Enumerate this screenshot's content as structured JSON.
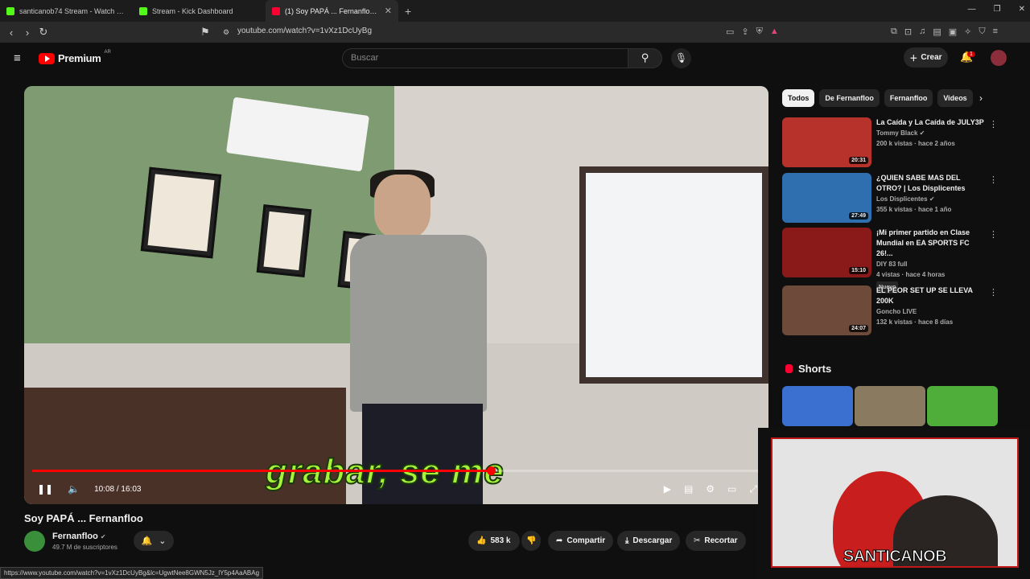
{
  "browser": {
    "tabs": [
      {
        "title": "santicanob74 Stream - Watch Live on",
        "favicon_color": "#53fc18"
      },
      {
        "title": "Stream - Kick Dashboard",
        "favicon_color": "#53fc18"
      },
      {
        "title": "(1) Soy PAPÁ ... Fernanfloo - Y",
        "favicon_color": "#ff0033"
      }
    ],
    "new_tab": "+",
    "url": "youtube.com/watch?v=1vXz1DcUyBg",
    "status_url": "https://www.youtube.com/watch?v=1vXz1DcUyBg&lc=UgwtNee8GWN5Jz_lY5p4AaABAg"
  },
  "header": {
    "logo_word": "Premium",
    "country": "AR",
    "search_placeholder": "Buscar",
    "create_label": "Crear",
    "notification_count": "1"
  },
  "player": {
    "subtitle": "grabar, se me",
    "current_time": "10:08",
    "duration": "16:03",
    "time_display": "10:08 / 16:03",
    "progress_fraction": 0.63
  },
  "video_info": {
    "title": "Soy PAPÁ ... Fernanfloo",
    "channel": "Fernanfloo",
    "subscribers": "49.7 M de suscriptores",
    "likes": "583 k",
    "share_label": "Compartir",
    "download_label": "Descargar",
    "clip_label": "Recortar"
  },
  "chips": [
    "Todos",
    "De Fernanfloo",
    "Fernanfloo",
    "Videos"
  ],
  "recommendations": [
    {
      "title": "La Caída y La Caída de JULY3P",
      "channel": "Tommy Black",
      "meta": "200 k vistas · hace 2 años",
      "duration": "20:31",
      "verified": true,
      "thumb_color": "#b8322c"
    },
    {
      "title": "¿QUIEN SABE MAS DEL OTRO? | Los Displicentes",
      "channel": "Los Displicentes",
      "meta": "355 k vistas · hace 1 año",
      "duration": "27:49",
      "verified": true,
      "thumb_color": "#2f6fb0"
    },
    {
      "title": "¡Mi primer partido en Clase Mundial en EA SPORTS FC 26!...",
      "channel": "DIY 83 full",
      "meta": "4 vistas · hace 4 horas",
      "duration": "15:10",
      "verified": false,
      "badge": "Nuevo",
      "thumb_color": "#8a1a1a"
    },
    {
      "title": "EL PEOR SET UP SE LLEVA 200K",
      "channel": "Goncho LIVE",
      "meta": "132 k vistas · hace 8 días",
      "duration": "24:07",
      "verified": false,
      "thumb_color": "#6d4a3a"
    }
  ],
  "shorts_label": "Shorts",
  "webcam": {
    "name": "SANTICANOB"
  }
}
